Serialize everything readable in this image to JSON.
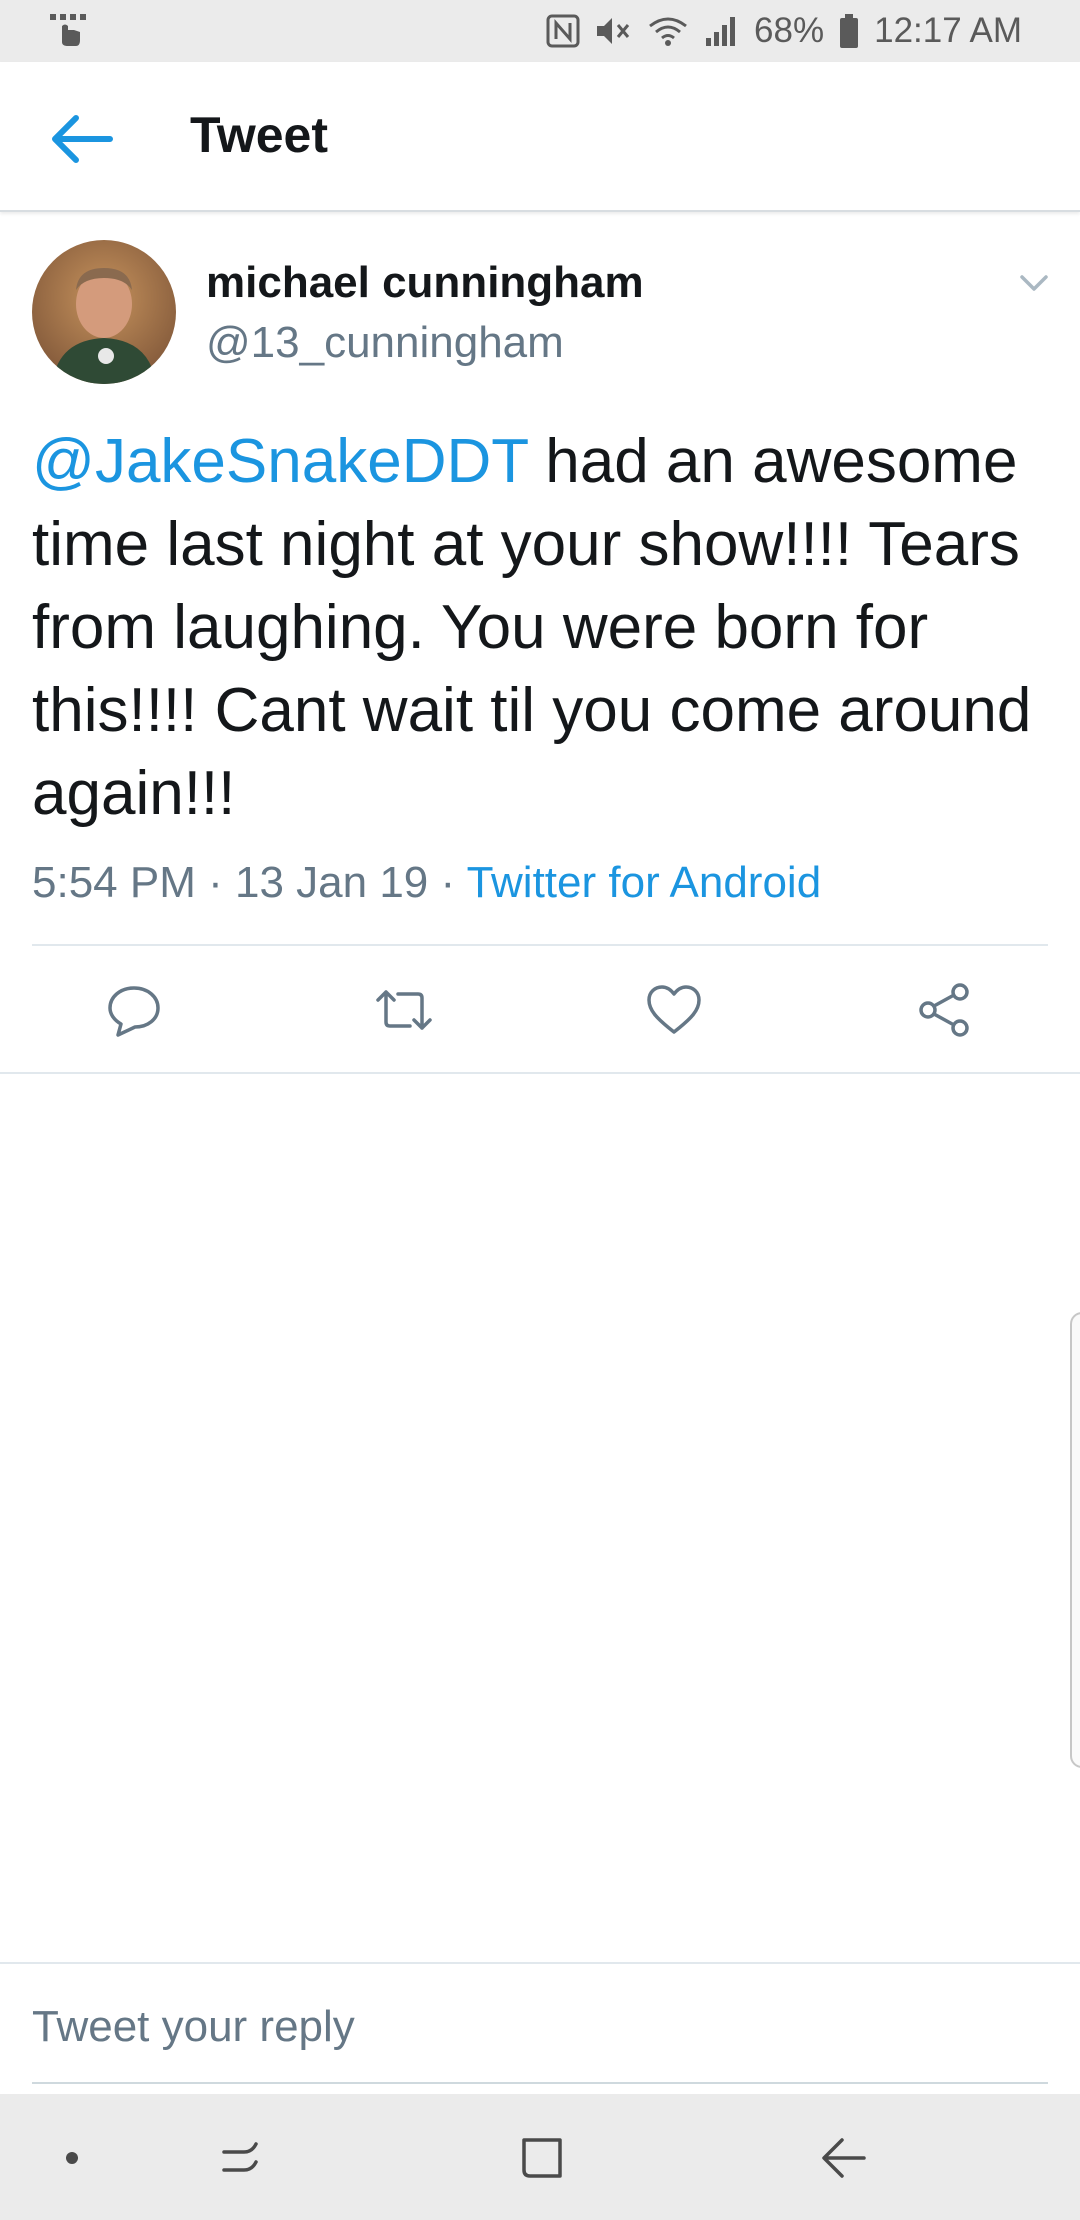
{
  "status_bar": {
    "battery": "68%",
    "time": "12:17 AM",
    "icons": [
      "touch-icon",
      "nfc-icon",
      "mute-icon",
      "wifi-icon",
      "signal-icon",
      "battery-icon"
    ]
  },
  "app_bar": {
    "title": "Tweet",
    "back_icon": "arrow-left-icon"
  },
  "tweet": {
    "author": {
      "name": "michael cunningham",
      "handle": "@13_cunningham"
    },
    "mention": "@JakeSnakeDDT",
    "body": " had an awesome time last night at your show!!!! Tears from laughing. You were born for this!!!! Cant wait til you come around again!!!",
    "time": "5:54 PM",
    "separator": " · ",
    "date": "13 Jan 19",
    "source": "Twitter for Android"
  },
  "actions": [
    {
      "icon": "reply-icon"
    },
    {
      "icon": "retweet-icon"
    },
    {
      "icon": "heart-icon"
    },
    {
      "icon": "share-icon"
    }
  ],
  "reply": {
    "placeholder": "Tweet your reply"
  },
  "colors": {
    "accent": "#1b95e0",
    "text": "#14171a",
    "secondary": "#657786"
  }
}
